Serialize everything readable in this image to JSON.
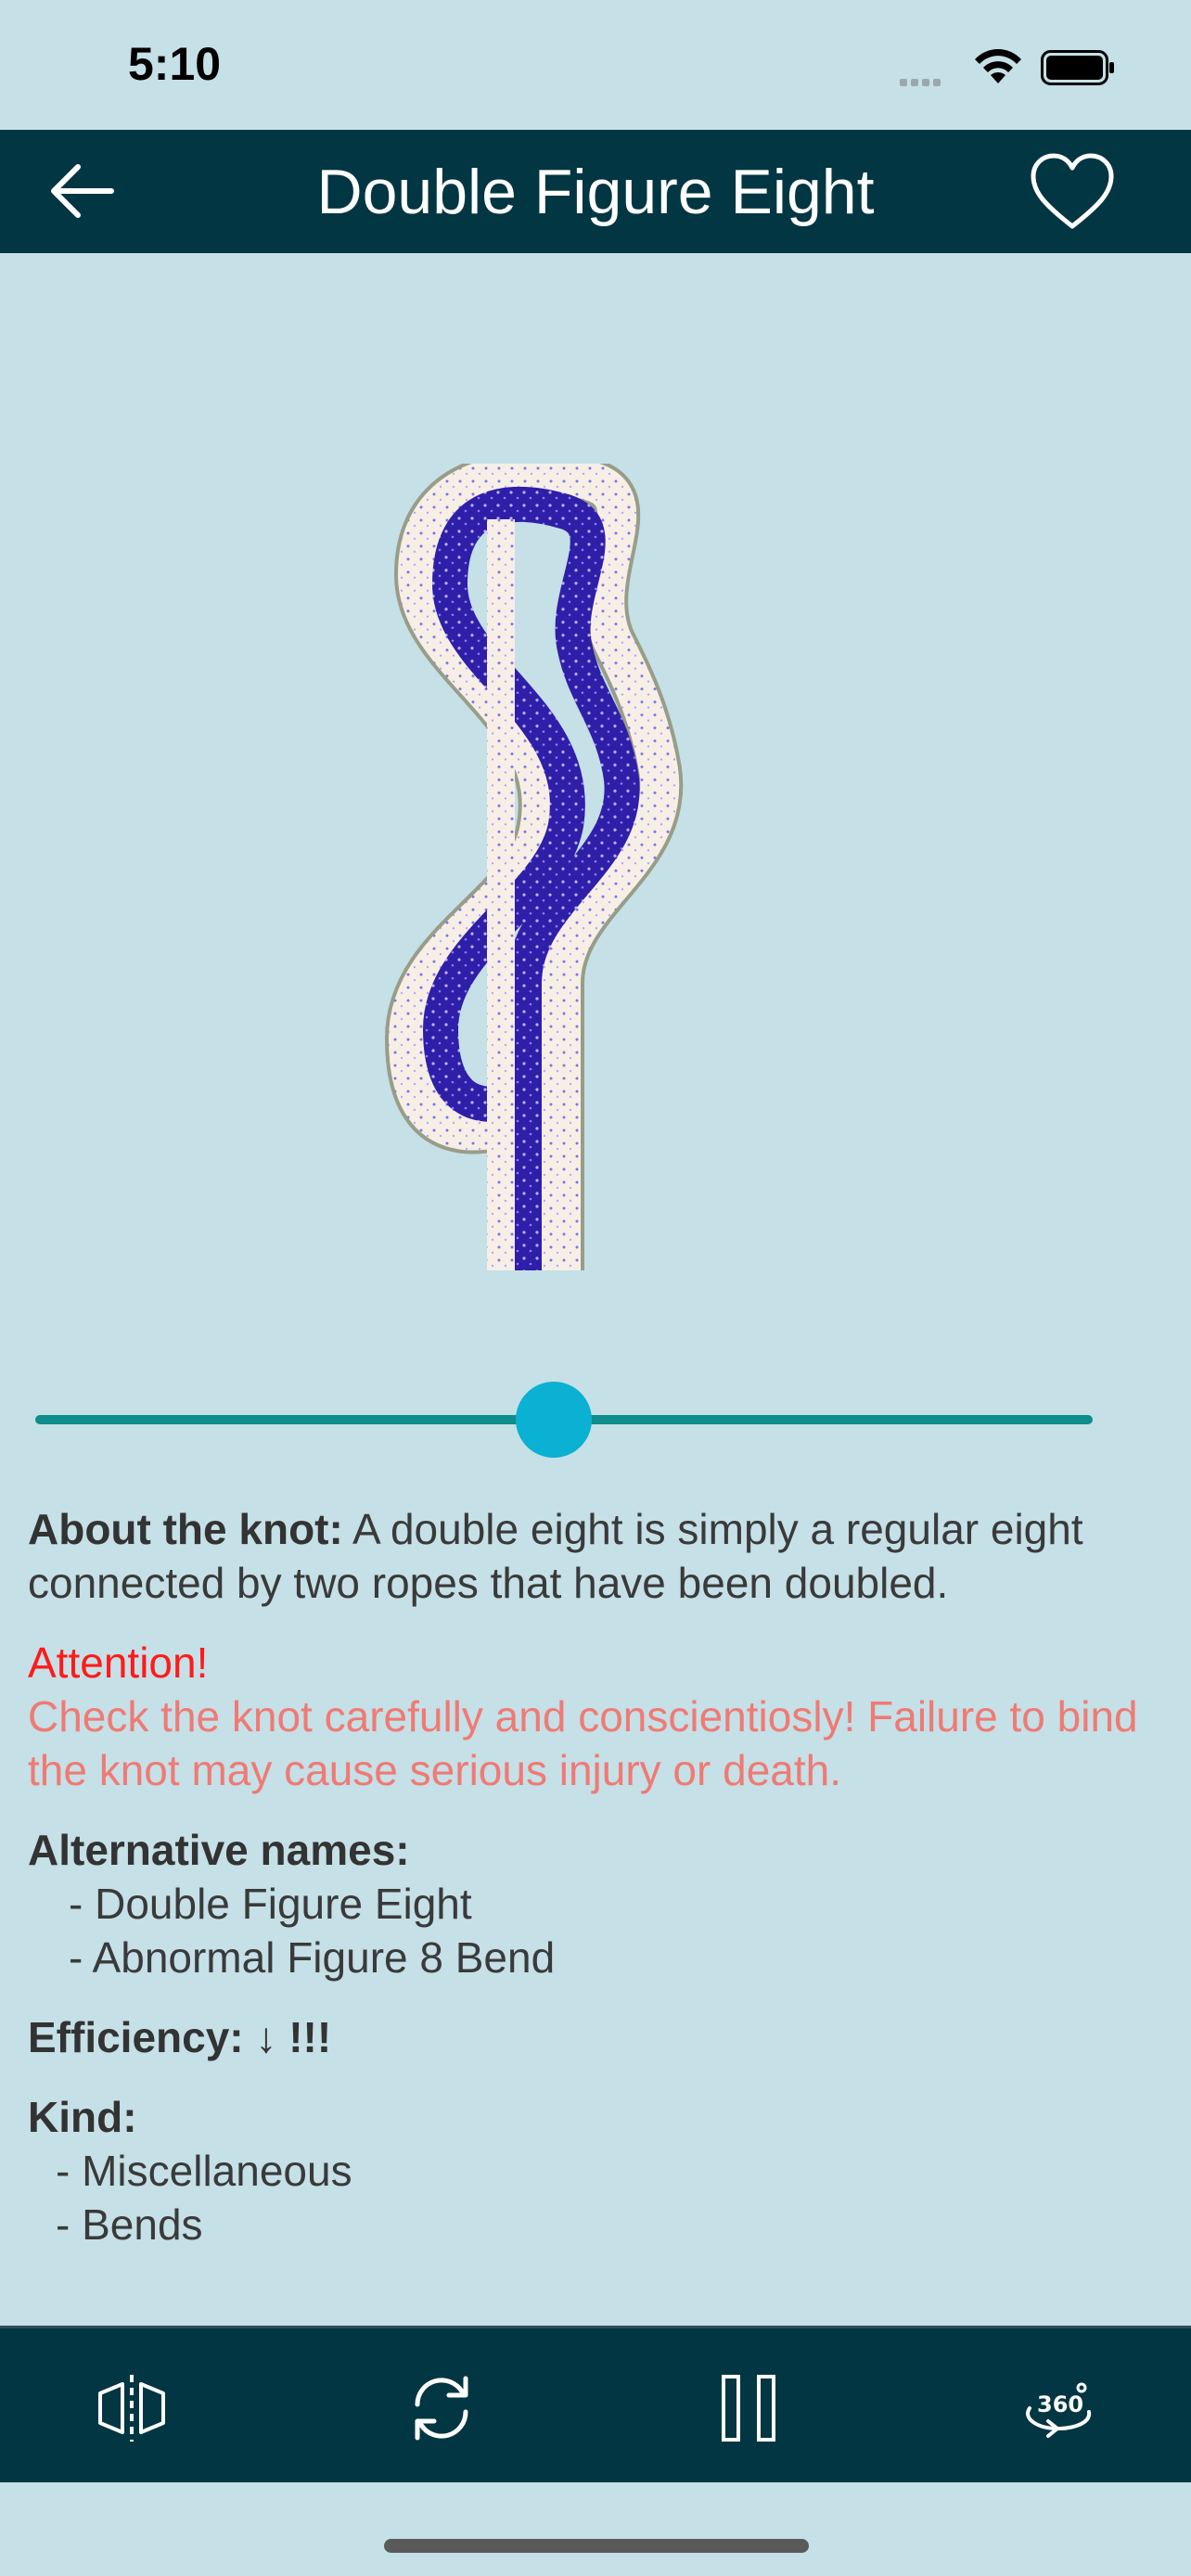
{
  "status": {
    "time": "5:10"
  },
  "header": {
    "title": "Double Figure Eight",
    "back_icon": "arrow-left-icon",
    "favorite_icon": "heart-outline-icon"
  },
  "slider": {
    "value_fraction": 0.49
  },
  "about": {
    "label": "About the knot:",
    "text": " A double eight is simply a regular eight connected by two ropes that have been doubled."
  },
  "attention": {
    "title": "Attention!",
    "text": "Check the knot carefully and conscientiosly! Failure to bind the knot may cause serious injury or death."
  },
  "alternative_names": {
    "label": "Alternative names:",
    "items": [
      "- Double Figure Eight",
      "- Abnormal Figure 8 Bend"
    ]
  },
  "efficiency": {
    "label": "Efficiency: ↓ !!!"
  },
  "kind": {
    "label": "Kind:",
    "items": [
      "- Miscellaneous",
      "- Bends"
    ]
  },
  "toolbar": {
    "icons": [
      "mirror-icon",
      "refresh-icon",
      "pause-icon",
      "rotate-360-icon"
    ]
  },
  "colors": {
    "header_bg": "#023642",
    "page_bg": "#c5e0e6",
    "accent": "#0ab1d2",
    "rope_blue": "#2e1ea8",
    "rope_white": "#f4ebe0"
  }
}
